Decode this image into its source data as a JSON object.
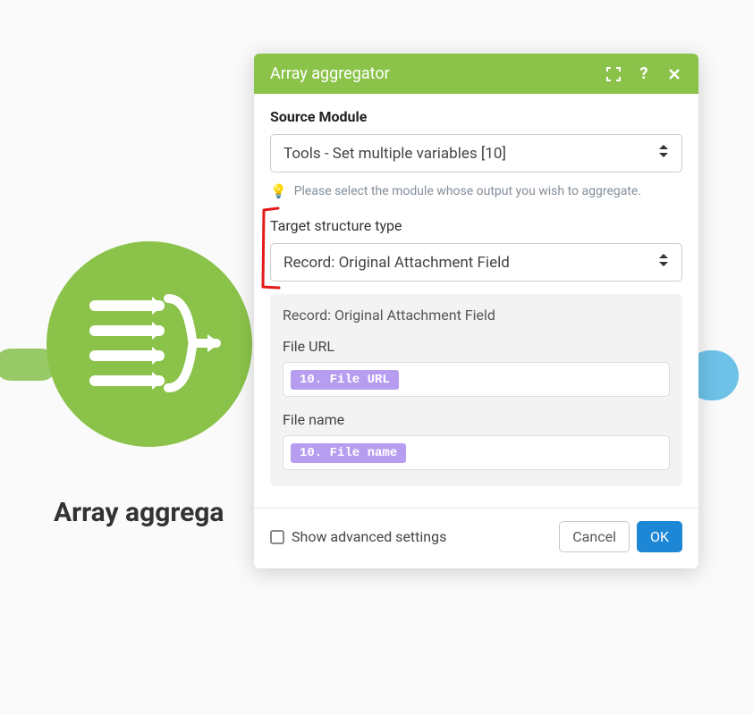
{
  "canvas": {
    "module_label": "Array aggrega"
  },
  "dialog": {
    "title": "Array aggregator",
    "source_module": {
      "label": "Source Module",
      "value": "Tools - Set multiple variables [10]",
      "hint": "Please select the module whose output you wish to aggregate."
    },
    "target_structure": {
      "label": "Target structure type",
      "value": "Record: Original Attachment Field"
    },
    "mapping": {
      "title": "Record: Original Attachment Field",
      "fields": [
        {
          "label": "File URL",
          "pill": "10. File URL"
        },
        {
          "label": "File name",
          "pill": "10. File name"
        }
      ]
    },
    "footer": {
      "advanced_label": "Show advanced settings",
      "cancel": "Cancel",
      "ok": "OK"
    }
  }
}
